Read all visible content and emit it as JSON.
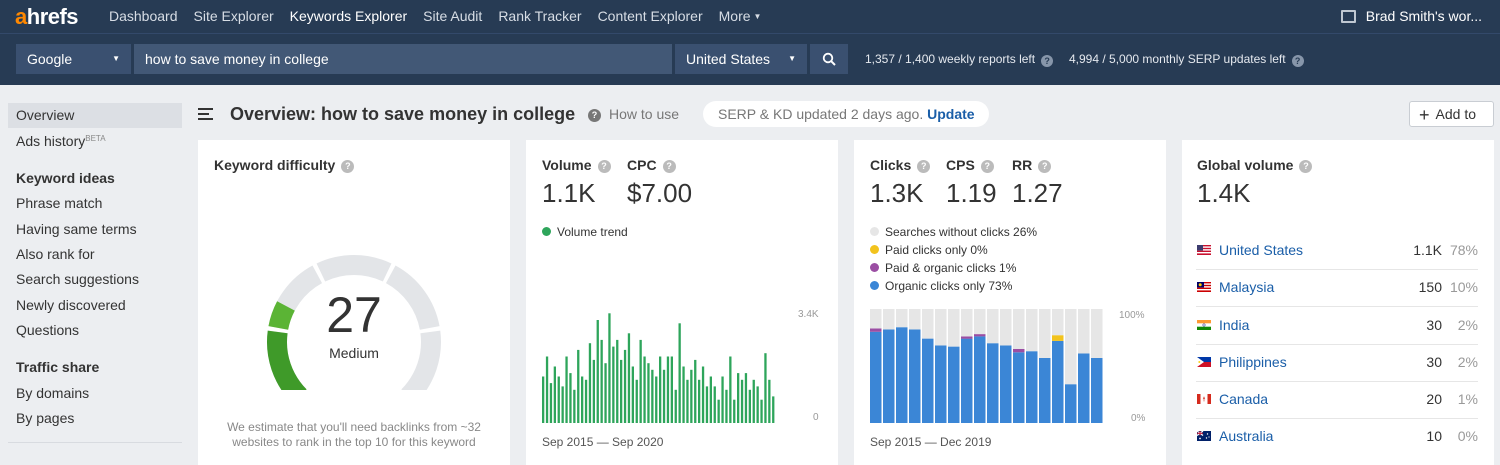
{
  "topnav": {
    "logo_a": "a",
    "logo_rest": "hrefs",
    "items": [
      "Dashboard",
      "Site Explorer",
      "Keywords Explorer",
      "Site Audit",
      "Rank Tracker",
      "Content Explorer"
    ],
    "active": "Keywords Explorer",
    "more": "More",
    "account": "Brad Smith's wor..."
  },
  "search": {
    "engine": "Google",
    "query": "how to save money in college",
    "country": "United States",
    "weekly_reports": "1,357 / 1,400 weekly reports left",
    "serp_updates": "4,994 / 5,000 monthly SERP updates left"
  },
  "sidebar": {
    "overview": "Overview",
    "ads_history": "Ads history",
    "ads_beta": "BETA",
    "keyword_ideas": "Keyword ideas",
    "phrase_match": "Phrase match",
    "same_terms": "Having same terms",
    "also_rank": "Also rank for",
    "suggestions": "Search suggestions",
    "newly": "Newly discovered",
    "questions": "Questions",
    "traffic_share": "Traffic share",
    "by_domains": "By domains",
    "by_pages": "By pages"
  },
  "header": {
    "title": "Overview: how to save money in college",
    "how_to_use": "How to use",
    "serp_text": "SERP & KD updated 2 days ago.",
    "update": "Update",
    "add_to": "Add to"
  },
  "kd": {
    "label": "Keyword difficulty",
    "value": "27",
    "level": "Medium",
    "score": 27,
    "note": "We estimate that you'll need backlinks from ~32 websites to rank in the top 10 for this keyword",
    "colors": {
      "active": "#5bb435",
      "active_dark": "#3f9a29",
      "inactive": "#e3e5e8"
    }
  },
  "volume": {
    "label": "Volume",
    "value": "1.1K",
    "cpc_label": "CPC",
    "cpc_value": "$7.00",
    "trend_label": "Volume trend",
    "trend_color": "#2ea55b",
    "y_max_label": "3.4K",
    "y_min_label": "0",
    "range": "Sep 2015 — Sep 2020"
  },
  "clicks": {
    "label": "Clicks",
    "value": "1.3K",
    "cps_label": "CPS",
    "cps_value": "1.19",
    "rr_label": "RR",
    "rr_value": "1.27",
    "legend": [
      {
        "label": "Searches without clicks 26%",
        "color": "#e6e6e6"
      },
      {
        "label": "Paid clicks only 0%",
        "color": "#f2c31d"
      },
      {
        "label": "Paid & organic clicks 1%",
        "color": "#9b4ea3"
      },
      {
        "label": "Organic clicks only 73%",
        "color": "#3b86d6"
      }
    ],
    "y_max_label": "100%",
    "y_min_label": "0%",
    "range": "Sep 2015 — Dec 2019"
  },
  "global": {
    "label": "Global volume",
    "value": "1.4K",
    "rows": [
      {
        "country": "United States",
        "volume": "1.1K",
        "pct": "78%"
      },
      {
        "country": "Malaysia",
        "volume": "150",
        "pct": "10%"
      },
      {
        "country": "India",
        "volume": "30",
        "pct": "2%"
      },
      {
        "country": "Philippines",
        "volume": "30",
        "pct": "2%"
      },
      {
        "country": "Canada",
        "volume": "20",
        "pct": "1%"
      },
      {
        "country": "Australia",
        "volume": "10",
        "pct": "0%"
      }
    ]
  },
  "chart_data": [
    {
      "type": "bar",
      "title": "Volume trend",
      "x_range": [
        "Sep 2015",
        "Sep 2020"
      ],
      "ylim": [
        0,
        3400
      ],
      "values": [
        1400,
        2000,
        1200,
        1700,
        1400,
        1100,
        2000,
        1500,
        1000,
        2200,
        1400,
        1300,
        2400,
        1900,
        3100,
        2500,
        1800,
        3300,
        2300,
        2500,
        1900,
        2200,
        2700,
        1700,
        1300,
        2500,
        2000,
        1800,
        1600,
        1400,
        2000,
        1600,
        2000,
        2000,
        1000,
        3000,
        1700,
        1300,
        1600,
        1900,
        1300,
        1700,
        1100,
        1400,
        1100,
        700,
        1400,
        1000,
        2000,
        700,
        1500,
        1300,
        1500,
        1000,
        1300,
        1100,
        700,
        2100,
        1300,
        800
      ]
    },
    {
      "type": "bar",
      "stacked": true,
      "title": "Clicks breakdown",
      "x_range": [
        "Sep 2015",
        "Dec 2019"
      ],
      "ylim": [
        0,
        100
      ],
      "series": [
        {
          "name": "Organic clicks only",
          "values": [
            80,
            82,
            84,
            82,
            74,
            68,
            67,
            74,
            76,
            70,
            68,
            62,
            63,
            57,
            72,
            34,
            61,
            57
          ]
        },
        {
          "name": "Paid & organic clicks",
          "values": [
            3,
            0,
            0,
            0,
            0,
            0,
            0,
            2,
            2,
            0,
            0,
            3,
            0,
            0,
            0,
            0,
            0,
            0
          ]
        },
        {
          "name": "Paid clicks only",
          "values": [
            0,
            0,
            0,
            0,
            0,
            0,
            0,
            0,
            0,
            0,
            0,
            0,
            0,
            0,
            5,
            0,
            0,
            0
          ]
        },
        {
          "name": "Searches without clicks",
          "values": [
            17,
            18,
            16,
            18,
            26,
            32,
            33,
            24,
            22,
            30,
            32,
            35,
            37,
            43,
            23,
            66,
            39,
            43
          ]
        }
      ]
    }
  ]
}
